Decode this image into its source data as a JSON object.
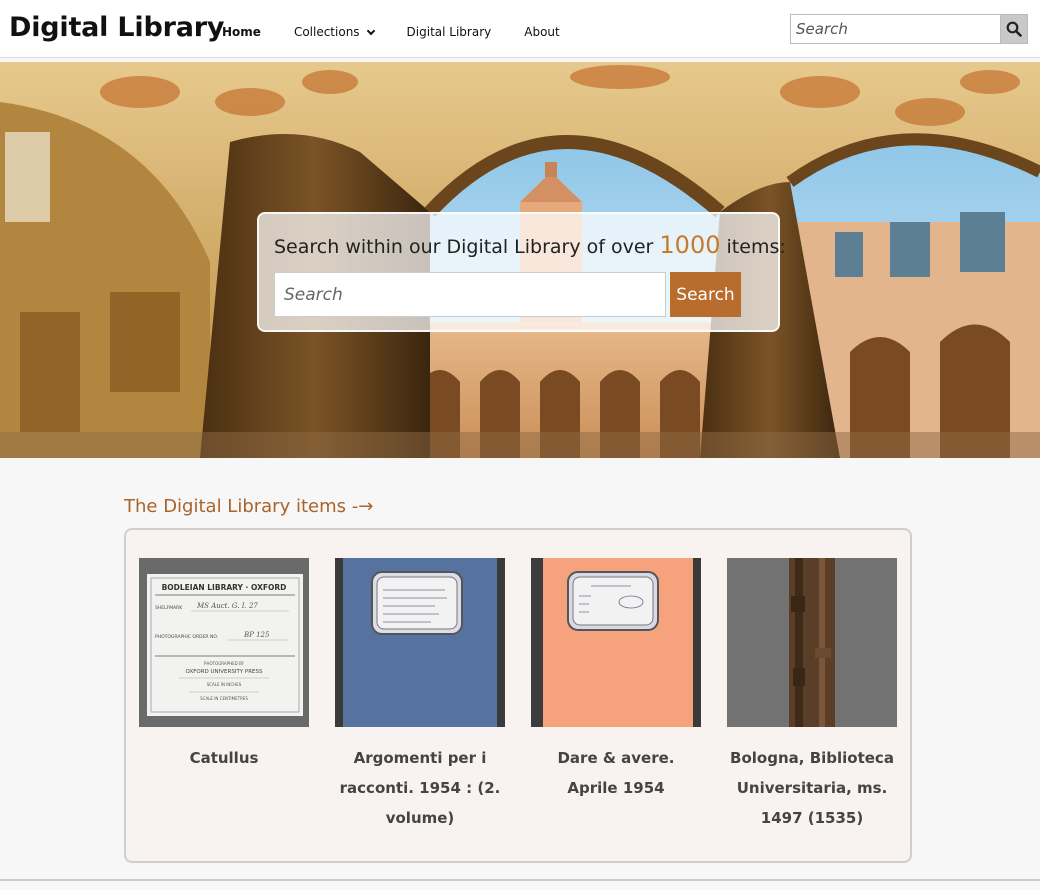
{
  "header": {
    "logo": "Digital Library",
    "nav": [
      {
        "label": "Home",
        "active": true
      },
      {
        "label": "Collections",
        "has_dropdown": true
      },
      {
        "label": "Digital Library"
      },
      {
        "label": "About"
      }
    ],
    "search": {
      "placeholder": "Search"
    }
  },
  "hero": {
    "text_before": "Search within our Digital Library of over ",
    "count": "1000",
    "text_after": " items:",
    "search_placeholder": "Search",
    "search_button": "Search"
  },
  "items": {
    "title": "The Digital Library items -→",
    "cards": [
      {
        "title": "Catullus"
      },
      {
        "title": "Argomenti per i racconti. 1954 : (2. volume)"
      },
      {
        "title": "Dare & avere. Aprile 1954"
      },
      {
        "title": "Bologna, Biblioteca Universitaria, ms. 1497 (1535)"
      }
    ],
    "card1_label": {
      "line1": "BODLEIAN LIBRARY · OXFORD",
      "shelfmark_label": "SHELFMARK",
      "shelfmark_value": "MS Auct. G. I. 27",
      "order_label": "PHOTOGRAPHIC ORDER NO.",
      "order_value": "BP 125",
      "photographed_by": "PHOTOGRAPHED BY",
      "press": "OXFORD UNIVERSITY PRESS",
      "scale_inches": "SCALE IN INCHES",
      "scale_cm": "SCALE IN CENTIMETRES"
    }
  },
  "colors": {
    "accent": "#b86c2e",
    "count": "#c77a2e",
    "title": "#a8642a",
    "cover_blue": "#5673a0",
    "cover_orange": "#f6a27c"
  }
}
